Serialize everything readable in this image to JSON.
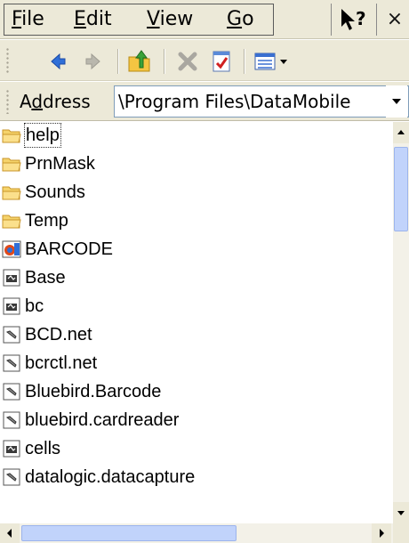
{
  "menubar": {
    "items": [
      {
        "first": "F",
        "rest": "ile"
      },
      {
        "first": "E",
        "rest": "dit"
      },
      {
        "first": "V",
        "rest": "iew"
      },
      {
        "first": "G",
        "rest": "o"
      }
    ],
    "help_icon": "context-help-icon",
    "close_label": "×"
  },
  "toolbar": {
    "icons": [
      "back-arrow-icon",
      "forward-arrow-icon",
      "up-folder-icon",
      "delete-icon",
      "properties-icon",
      "view-menu-icon"
    ]
  },
  "address": {
    "label_pre": "A",
    "label_under": "d",
    "label_post": "dress",
    "value": "\\Program Files\\DataMobile"
  },
  "files": [
    {
      "name": "help",
      "icon": "folder-icon",
      "focused": true
    },
    {
      "name": "PrnMask",
      "icon": "folder-icon"
    },
    {
      "name": "Sounds",
      "icon": "folder-icon"
    },
    {
      "name": "Temp",
      "icon": "folder-icon"
    },
    {
      "name": "BARCODE",
      "icon": "application-icon"
    },
    {
      "name": "Base",
      "icon": "document-icon"
    },
    {
      "name": "bc",
      "icon": "document-icon"
    },
    {
      "name": "BCD.net",
      "icon": "library-icon"
    },
    {
      "name": "bcrctl.net",
      "icon": "library-icon"
    },
    {
      "name": "Bluebird.Barcode",
      "icon": "library-icon"
    },
    {
      "name": "bluebird.cardreader",
      "icon": "library-icon"
    },
    {
      "name": "cells",
      "icon": "document-icon"
    },
    {
      "name": "datalogic.datacapture",
      "icon": "library-icon"
    }
  ],
  "colors": {
    "chrome": "#ece9d8",
    "folder": "#f5d36b",
    "scroll_thumb": "#c1d3fb",
    "back_arrow": "#2f6fd8"
  }
}
